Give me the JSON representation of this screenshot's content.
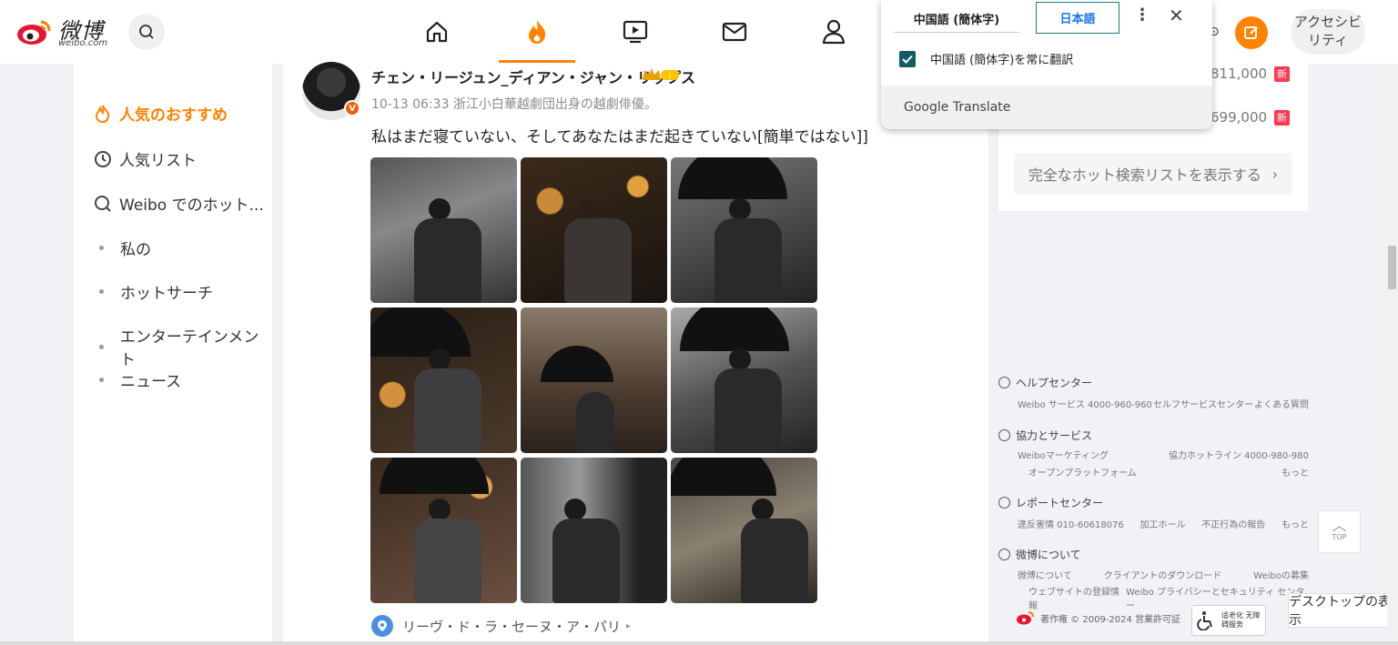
{
  "topbar": {
    "brand": "微博",
    "brand_sub": "weibo.com",
    "nav_items": [
      "home-icon",
      "hot-flame-icon",
      "video-icon",
      "mail-icon",
      "profile-icon"
    ],
    "accessibility_label": "アクセシビリティ",
    "accent_color": "#ff8200"
  },
  "translate": {
    "source_tab": "中国語 (簡体字)",
    "target_tab": "日本語",
    "always_translate": "中国語 (簡体字)を常に翻訳",
    "always_translate_checked": true,
    "footer": "Google Translate"
  },
  "sidebar": {
    "items": [
      {
        "label": "人気のおすすめ",
        "icon": "flame-icon",
        "active": true
      },
      {
        "label": "人気リスト",
        "icon": "ranking-icon",
        "active": false
      },
      {
        "label": "Weibo でのホット...",
        "icon": "search-hot-icon",
        "active": false
      },
      {
        "label": "私の",
        "icon": "dot",
        "active": false
      },
      {
        "label": "ホットサーチ",
        "icon": "dot",
        "active": false
      },
      {
        "label": "エンターテインメント",
        "icon": "dot",
        "active": false
      },
      {
        "label": "ニュース",
        "icon": "dot",
        "active": false
      }
    ]
  },
  "post": {
    "user": "チェン・リージュン_ディアン・ジャン・リップス",
    "badge": "V",
    "meta": "10-13 06:33 浙江小白華越劇団出身の越劇俳優。",
    "text": "私はまだ寝ていない、そしてあなたはまだ起きていない[簡単ではない]]",
    "photo_count": 9,
    "location": "リーヴ・ド・ラ・セーヌ・ア・パリ"
  },
  "hot": {
    "rows": [
      {
        "count": "811,000",
        "tag": "新"
      },
      {
        "count": "699,000",
        "tag": "新"
      }
    ],
    "full_list": "完全なホット検索リストを表示する"
  },
  "footer": {
    "sections": [
      {
        "title": "ヘルプセンター",
        "lines": [
          [
            "Weibo サービス 4000-960-960",
            "セルフサービスセンター",
            "よくある質問"
          ]
        ]
      },
      {
        "title": "協力とサービス",
        "lines": [
          [
            "Weiboマーケティング",
            "協力ホットライン 4000-980-980"
          ],
          [
            "オープンプラットフォーム",
            "もっと"
          ]
        ]
      },
      {
        "title": "レポートセンター",
        "lines": [
          [
            "違反害情 010-60618076",
            "加工ホール",
            "不正行為の報告",
            "もっと"
          ]
        ]
      },
      {
        "title": "微博について",
        "lines": [
          [
            "微博について",
            "クライアントのダウンロード",
            "Weiboの募集"
          ],
          [
            "ウェブサイトの登録情報",
            "Weibo プライバシーとセキュリティ センター"
          ]
        ]
      }
    ],
    "copyright": "著作権 © 2009-2024 営業許可証",
    "a11y_badge": "适老化 无障碍服务"
  },
  "top_button": "TOP",
  "desktop_button": "デスクトップの表示"
}
